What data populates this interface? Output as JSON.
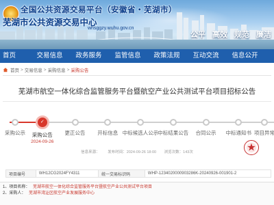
{
  "banner": {
    "title_line1": "全国公共资源交易平台（安徽省・芜湖市）",
    "title_line2": "芜湖市公共资源交易中心",
    "site_url": "whsggzy.wuhu.gov.cn",
    "slogans": [
      "公平",
      "高效",
      "规范",
      "廉洁"
    ]
  },
  "nav": {
    "items": [
      "首页",
      "交易信息",
      "政务服务",
      "监管信息",
      "政策法规",
      "互动交流",
      "信息公开"
    ]
  },
  "breadcrumb": {
    "items": [
      "首页",
      "交易信息",
      "采购信息",
      "采购公告"
    ]
  },
  "article": {
    "title": "芜湖市航空一体化综合监管服务平台暨航空产业公共测试平台项目招标公告"
  },
  "progress": {
    "fill_percent": 13,
    "steps": [
      {
        "label": "采购公示",
        "date": "",
        "active": false
      },
      {
        "label": "采购公告",
        "date": "2024-09-26",
        "active": true
      },
      {
        "label": "更正公告",
        "date": "",
        "active": false
      },
      {
        "label": "开标信息",
        "date": "",
        "active": false
      },
      {
        "label": "中标候选人公示",
        "date": "",
        "active": false
      },
      {
        "label": "中标结果公告",
        "date": "",
        "active": false
      },
      {
        "label": "合同公示",
        "date": "",
        "active": false
      },
      {
        "label": "中标通知书",
        "date": "",
        "active": false
      },
      {
        "label": "项目异常",
        "date": "",
        "active": false
      }
    ],
    "active_step_marker": "✓"
  },
  "meta": {
    "source": "信息来源：",
    "time": "发布时间：2024-09-26 18:00",
    "views": "浏览次数：143次"
  },
  "table": {
    "project_no_label": "项目编号",
    "project_no": "WH12CG2024FY4311",
    "entity_code_label": "统一交易标识码",
    "entity_code": "WHP-1234020000903286K-20240926-001901-2"
  },
  "info": {
    "project_name_label": "1、项目名称：",
    "project_name": "芜湖市航空一体化综合监管服务平台暨航空产业公共测试平台项目",
    "agency_label": "2、采购人：",
    "agency": "芜湖市湾沚区航空产业发展服务中心"
  },
  "colors": {
    "nav_bg": "#1f5fad",
    "accent_red": "#d8362a"
  }
}
